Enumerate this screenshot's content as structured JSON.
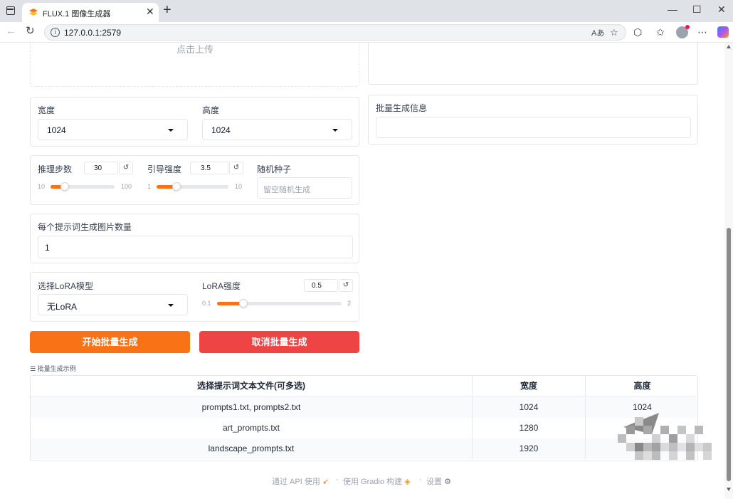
{
  "browser": {
    "tab_title": "FLUX.1 图像生成器",
    "tab_close": "✕",
    "new_tab": "+",
    "url": "127.0.0.1:2579",
    "window_controls": [
      "—",
      "☐",
      "✕"
    ]
  },
  "upload": {
    "label": "点击上传"
  },
  "batch_info": {
    "label": "批量生成信息",
    "value": ""
  },
  "size": {
    "width_label": "宽度",
    "width_value": "1024",
    "height_label": "高度",
    "height_value": "1024"
  },
  "params": {
    "steps_label": "推理步数",
    "steps_value": "30",
    "steps_min": "10",
    "steps_max": "100",
    "steps_level": 0.22,
    "guidance_label": "引导强度",
    "guidance_value": "3.5",
    "guidance_min": "1",
    "guidance_max": "10",
    "guidance_level": 0.28,
    "seed_label": "随机种子",
    "seed_placeholder": "留空随机生成",
    "reset_glyph": "↺"
  },
  "count": {
    "label": "每个提示词生成图片数量",
    "value": "1"
  },
  "lora": {
    "model_label": "选择LoRA模型",
    "model_value": "无LoRA",
    "strength_label": "LoRA强度",
    "strength_value": "0.5",
    "strength_min": "0.1",
    "strength_max": "2",
    "strength_level": 0.21
  },
  "buttons": {
    "start": "开始批量生成",
    "cancel": "取消批量生成"
  },
  "examples": {
    "label": "☰ 批量生成示例",
    "headers": [
      "选择提示词文本文件(可多选)",
      "宽度",
      "高度"
    ],
    "rows": [
      [
        "prompts1.txt, prompts2.txt",
        "1024",
        "1024"
      ],
      [
        "art_prompts.txt",
        "1280",
        ""
      ],
      [
        "landscape_prompts.txt",
        "1920",
        ""
      ]
    ]
  },
  "footer": {
    "api": "通过 API 使用",
    "sep1": "·",
    "gradio": "使用 Gradio 构建",
    "sep2": "·",
    "settings": "设置"
  },
  "colors": {
    "accent_orange": "#f97316",
    "cancel_red": "#ef4444"
  }
}
